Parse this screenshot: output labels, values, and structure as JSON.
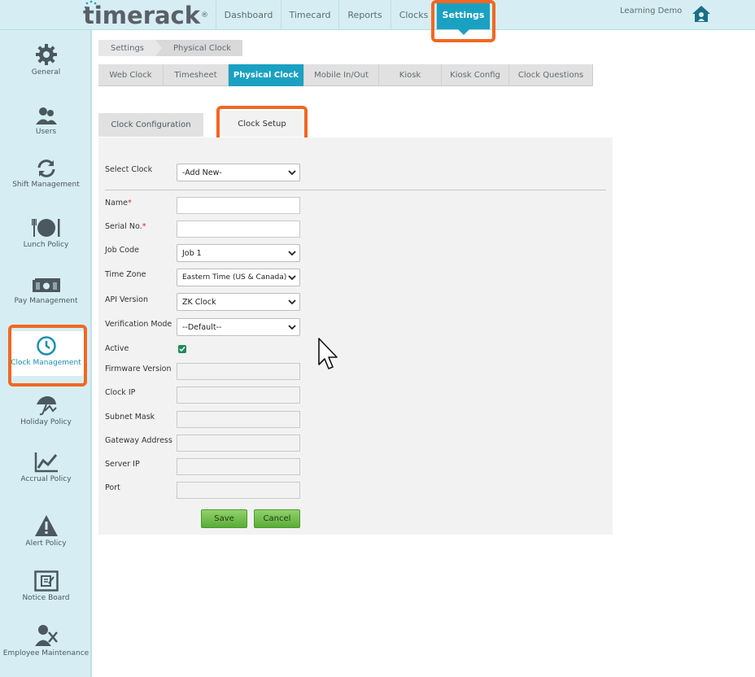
{
  "brand": {
    "logo": "timerack",
    "reg": "®"
  },
  "nav": {
    "items": [
      "Dashboard",
      "Timecard",
      "Reports",
      "Clocks",
      "Settings"
    ],
    "active": "Settings"
  },
  "user": {
    "name": "Learning Demo",
    "icon": "home-icon"
  },
  "sidebar": {
    "items": [
      {
        "label": "General",
        "icon": "gear-icon"
      },
      {
        "label": "Users",
        "icon": "users-icon"
      },
      {
        "label": "Shift Management",
        "icon": "refresh-icon"
      },
      {
        "label": "Lunch Policy",
        "icon": "plate-cutlery-icon"
      },
      {
        "label": "Pay Management",
        "icon": "money-icon"
      },
      {
        "label": "Clock Management",
        "icon": "clock-icon"
      },
      {
        "label": "Holiday Policy",
        "icon": "umbrella-icon"
      },
      {
        "label": "Accrual Policy",
        "icon": "chart-line-icon"
      },
      {
        "label": "Alert Policy",
        "icon": "warning-icon"
      },
      {
        "label": "Notice Board",
        "icon": "notice-board-icon"
      },
      {
        "label": "Employee Maintenance",
        "icon": "employee-tools-icon"
      }
    ],
    "active": "Clock Management"
  },
  "breadcrumb": [
    "Settings",
    "Physical Clock"
  ],
  "tabs": [
    "Web Clock",
    "Timesheet",
    "Physical Clock",
    "Mobile In/Out",
    "Kiosk",
    "Kiosk Config",
    "Clock Questions"
  ],
  "active_tab": "Physical Clock",
  "subtabs": [
    "Clock Configuration",
    "Clock Setup"
  ],
  "active_subtab": "Clock Setup",
  "form": {
    "select_clock": {
      "label": "Select Clock",
      "value": "-Add New-"
    },
    "name": {
      "label": "Name",
      "required": "*",
      "value": ""
    },
    "serial": {
      "label": "Serial No.",
      "required": "*",
      "value": ""
    },
    "job_code": {
      "label": "Job Code",
      "value": "Job 1"
    },
    "time_zone": {
      "label": "Time Zone",
      "value": "Eastern Time (US & Canada)"
    },
    "api_version": {
      "label": "API Version",
      "value": "ZK Clock"
    },
    "verification_mode": {
      "label": "Verification Mode",
      "value": "--Default--"
    },
    "active": {
      "label": "Active",
      "checked": true
    },
    "firmware_version": {
      "label": "Firmware Version",
      "value": ""
    },
    "clock_ip": {
      "label": "Clock IP",
      "value": ""
    },
    "subnet_mask": {
      "label": "Subnet Mask",
      "value": ""
    },
    "gateway_address": {
      "label": "Gateway Address",
      "value": ""
    },
    "server_ip": {
      "label": "Server IP",
      "value": ""
    },
    "port": {
      "label": "Port",
      "value": ""
    }
  },
  "buttons": {
    "save": "Save",
    "cancel": "Cancel"
  },
  "colors": {
    "accent": "#1aa1c2",
    "highlight": "#f26722",
    "button_green": "#5aac38",
    "sidebar_bg": "#d6eef3"
  }
}
